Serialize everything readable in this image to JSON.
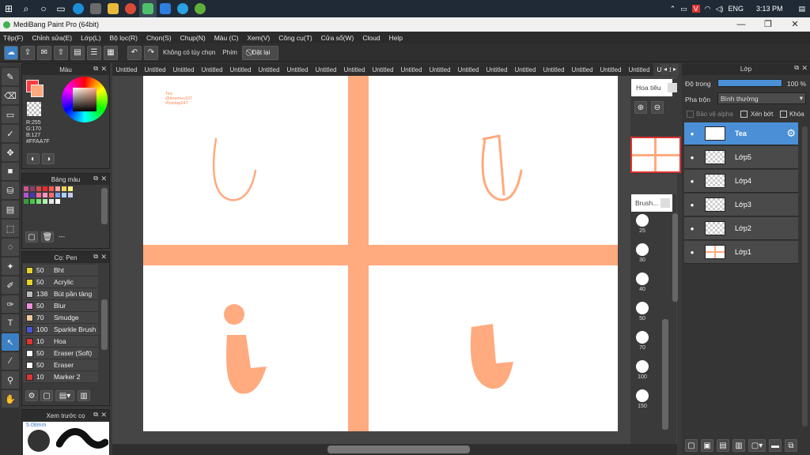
{
  "window": {
    "title": "MediBang Paint Pro (64bit)"
  },
  "taskbar": {
    "time": "3:13 PM",
    "lang": "ENG"
  },
  "menu": [
    "Tệp(F)",
    "Chỉnh sửa(E)",
    "Lớp(L)",
    "Bộ lọc(R)",
    "Chọn(S)",
    "Chụp(N)",
    "Màu (C)",
    "Xem(V)",
    "Công cụ(T)",
    "Cửa sổ(W)",
    "Cloud",
    "Help"
  ],
  "toolbar": {
    "selection_label": "Không có tùy chọn",
    "snap_label": "Phím",
    "reset_label": "Đặt lại"
  },
  "color_panel": {
    "title": "Màu",
    "r": "R:255",
    "g": "G:170",
    "b": "B:127",
    "hex": "#FFAA7F"
  },
  "palette_panel": {
    "title": "Bảng màu",
    "dash": "---"
  },
  "brush_panel": {
    "title": "Cọ: Pen",
    "items": [
      {
        "size": "50",
        "name": "Bht",
        "color": "#e8d22a"
      },
      {
        "size": "50",
        "name": "Acrylic",
        "color": "#e8d22a"
      },
      {
        "size": "138",
        "name": "Bút pần tảng",
        "color": "#bbbbbb"
      },
      {
        "size": "50",
        "name": "Blur",
        "color": "#f08fe0"
      },
      {
        "size": "70",
        "name": "Smudge",
        "color": "#f6c79a"
      },
      {
        "size": "100",
        "name": "Sparkle Brush",
        "color": "#4a55d8"
      },
      {
        "size": "10",
        "name": "Hoa",
        "color": "#e03434"
      },
      {
        "size": "50",
        "name": "Eraser (Soft)",
        "color": "#ffffff"
      },
      {
        "size": "50",
        "name": "Eraser",
        "color": "#ffffff"
      },
      {
        "size": "10",
        "name": "Marker 2",
        "color": "#e03434"
      }
    ]
  },
  "preview_panel": {
    "title": "Xem trước cọ",
    "size": "5.08mm"
  },
  "tabs": [
    "Untitled",
    "Untitled",
    "Untitled",
    "Untitled",
    "Untitled",
    "Untitled",
    "Untitled",
    "Untitled",
    "Untitled",
    "Untitled",
    "Untitled",
    "Untitled",
    "Untitled",
    "Untitled",
    "Untitled",
    "Untitled",
    "Untitled",
    "Untitled",
    "Untitled",
    "Untitled"
  ],
  "canvas": {
    "watermark_1": "Tea",
    "watermark_2": "@tinamvu107",
    "watermark_3": "#hoidap247",
    "accent": "#ffaa7f"
  },
  "navigator": {
    "title": "Hoa tiêu"
  },
  "brush_size_panel": {
    "title": "Brush...",
    "sizes": [
      "25",
      "30",
      "40",
      "50",
      "70",
      "100",
      "150"
    ]
  },
  "layers_panel": {
    "title": "Lớp",
    "opacity_label": "Độ trong",
    "opacity_value": "100 %",
    "blend_label": "Pha trộn",
    "blend_value": "Bình thường",
    "protect_alpha": "Bảo vệ alpha",
    "clipping": "Xén bớt",
    "lock": "Khóa",
    "layers": [
      {
        "name": "Tea",
        "selected": true
      },
      {
        "name": "Lớp5"
      },
      {
        "name": "Lớp4"
      },
      {
        "name": "Lớp3"
      },
      {
        "name": "Lớp2"
      },
      {
        "name": "Lớp1"
      }
    ]
  }
}
